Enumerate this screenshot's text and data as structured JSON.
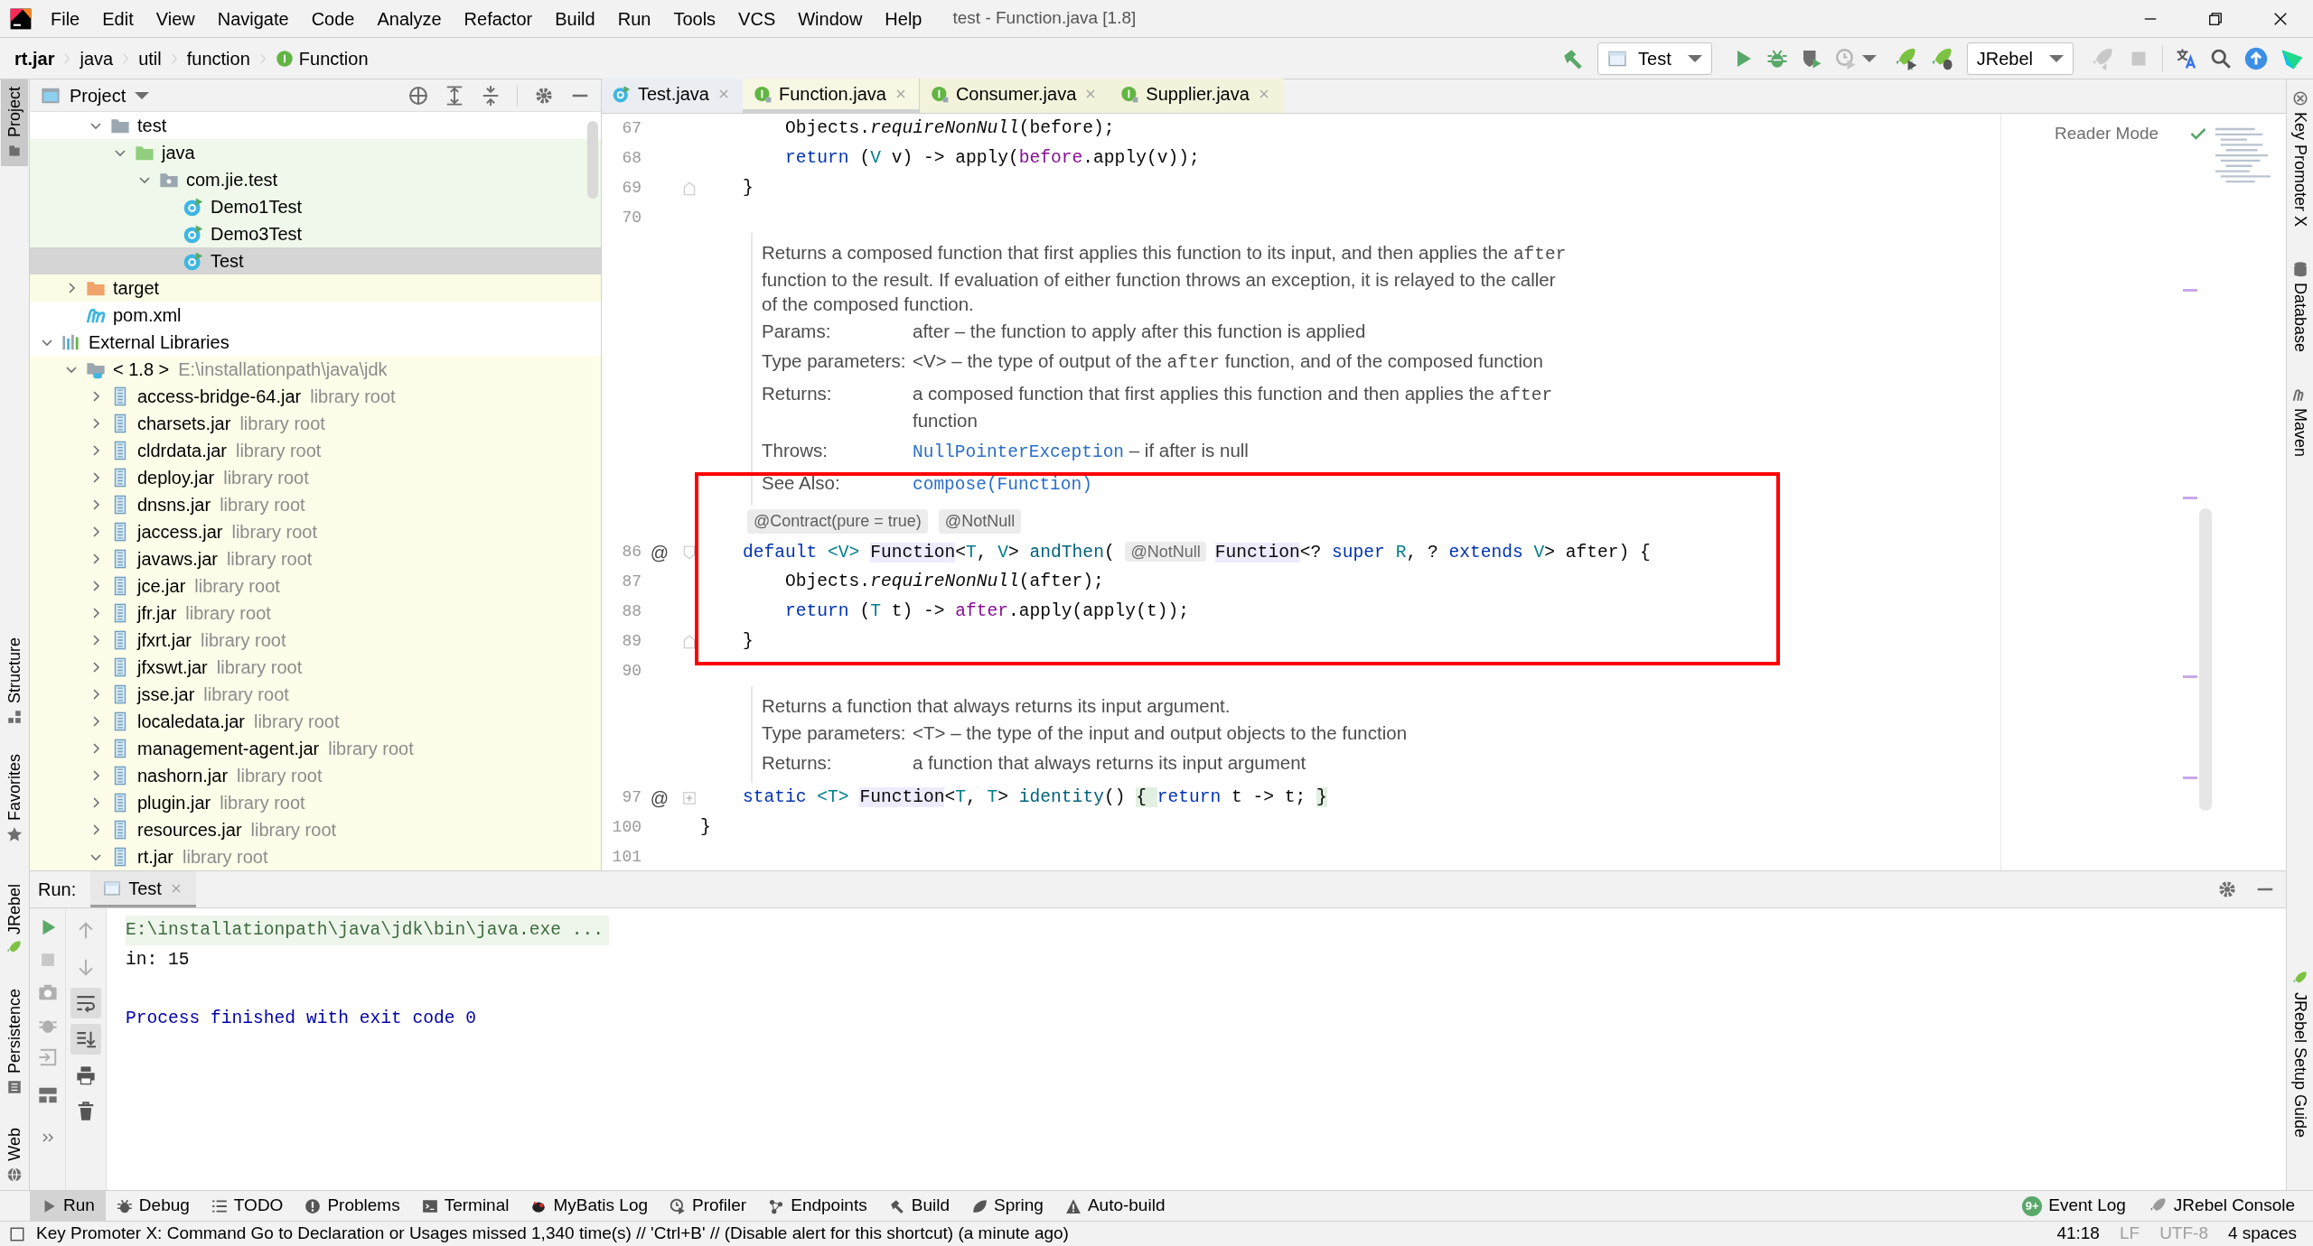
{
  "menu": [
    "File",
    "Edit",
    "View",
    "Navigate",
    "Code",
    "Analyze",
    "Refactor",
    "Build",
    "Run",
    "Tools",
    "VCS",
    "Window",
    "Help"
  ],
  "window_title": "test - Function.java [1.8]",
  "breadcrumbs": [
    {
      "label": "rt.jar",
      "kind": "jar"
    },
    {
      "label": "java",
      "kind": "dir"
    },
    {
      "label": "util",
      "kind": "dir"
    },
    {
      "label": "function",
      "kind": "dir"
    },
    {
      "label": "Function",
      "kind": "interface"
    }
  ],
  "run_config": "Test",
  "jrebel_config": "JRebel",
  "left_strip": {
    "top": [
      {
        "label": "Project",
        "selected": true
      }
    ],
    "middle": [
      {
        "label": "Structure",
        "selected": false
      },
      {
        "label": "Favorites",
        "selected": false
      }
    ],
    "bottom": [
      {
        "label": "JRebel",
        "selected": false
      },
      {
        "label": "Persistence",
        "selected": false
      },
      {
        "label": "Web",
        "selected": false
      }
    ]
  },
  "right_strip": {
    "top": [
      {
        "label": "Key Promoter X"
      },
      {
        "label": "Database"
      },
      {
        "label": "Maven"
      }
    ],
    "bottom": [
      {
        "label": "JRebel Setup Guide"
      }
    ]
  },
  "project_panel": {
    "title": "Project",
    "tree": [
      {
        "children": [
          {
            "children": [
              {
                "label": "test",
                "kind": "folder",
                "selected": false,
                "expanded": true,
                "children": [
                  {
                    "label": "java",
                    "kind": "test-folder",
                    "selected": false,
                    "expanded": true,
                    "children": [
                      {
                        "label": "com.jie.test",
                        "kind": "package",
                        "selected": false,
                        "expanded": true,
                        "children": [
                          {
                            "label": "Demo1Test",
                            "kind": "class",
                            "selected": false
                          },
                          {
                            "label": "Demo3Test",
                            "kind": "class",
                            "selected": false
                          },
                          {
                            "label": "Test",
                            "kind": "class",
                            "selected": true
                          }
                        ]
                      }
                    ]
                  }
                ]
              }
            ]
          },
          {
            "label": "target",
            "kind": "excluded-folder",
            "selected": false,
            "expanded": false
          },
          {
            "label": "pom.xml",
            "kind": "maven",
            "selected": false
          }
        ]
      },
      {
        "label": "External Libraries",
        "kind": "libraries",
        "selected": false,
        "expanded": true,
        "children": [
          {
            "label": "< 1.8 >",
            "hint": "E:\\installationpath\\java\\jdk",
            "kind": "jdk",
            "selected": false,
            "expanded": true,
            "children": [
              {
                "label": "access-bridge-64.jar",
                "hint": "library root",
                "kind": "jar",
                "selected": false,
                "expanded": false
              },
              {
                "label": "charsets.jar",
                "hint": "library root",
                "kind": "jar",
                "selected": false,
                "expanded": false
              },
              {
                "label": "cldrdata.jar",
                "hint": "library root",
                "kind": "jar",
                "selected": false,
                "expanded": false
              },
              {
                "label": "deploy.jar",
                "hint": "library root",
                "kind": "jar",
                "selected": false,
                "expanded": false
              },
              {
                "label": "dnsns.jar",
                "hint": "library root",
                "kind": "jar",
                "selected": false,
                "expanded": false
              },
              {
                "label": "jaccess.jar",
                "hint": "library root",
                "kind": "jar",
                "selected": false,
                "expanded": false
              },
              {
                "label": "javaws.jar",
                "hint": "library root",
                "kind": "jar",
                "selected": false,
                "expanded": false
              },
              {
                "label": "jce.jar",
                "hint": "library root",
                "kind": "jar",
                "selected": false,
                "expanded": false
              },
              {
                "label": "jfr.jar",
                "hint": "library root",
                "kind": "jar",
                "selected": false,
                "expanded": false
              },
              {
                "label": "jfxrt.jar",
                "hint": "library root",
                "kind": "jar",
                "selected": false,
                "expanded": false
              },
              {
                "label": "jfxswt.jar",
                "hint": "library root",
                "kind": "jar",
                "selected": false,
                "expanded": false
              },
              {
                "label": "jsse.jar",
                "hint": "library root",
                "kind": "jar",
                "selected": false,
                "expanded": false
              },
              {
                "label": "localedata.jar",
                "hint": "library root",
                "kind": "jar",
                "selected": false,
                "expanded": false
              },
              {
                "label": "management-agent.jar",
                "hint": "library root",
                "kind": "jar",
                "selected": false,
                "expanded": false
              },
              {
                "label": "nashorn.jar",
                "hint": "library root",
                "kind": "jar",
                "selected": false,
                "expanded": false
              },
              {
                "label": "plugin.jar",
                "hint": "library root",
                "kind": "jar",
                "selected": false,
                "expanded": false
              },
              {
                "label": "resources.jar",
                "hint": "library root",
                "kind": "jar",
                "selected": false,
                "expanded": false
              },
              {
                "label": "rt.jar",
                "hint": "library root",
                "kind": "jar",
                "selected": false,
                "expanded": true
              }
            ]
          }
        ]
      }
    ]
  },
  "editor_tabs": [
    {
      "label": "Test.java",
      "kind": "class",
      "library": false,
      "selected": false
    },
    {
      "label": "Function.java",
      "kind": "interface",
      "library": true,
      "selected": true
    },
    {
      "label": "Consumer.java",
      "kind": "interface",
      "library": true,
      "selected": false
    },
    {
      "label": "Supplier.java",
      "kind": "interface",
      "library": true,
      "selected": false
    }
  ],
  "reader_mode": "Reader Mode",
  "editor_rows": [
    {
      "kind": "code",
      "line": "67",
      "tokens": [
        {
          "text": "        Objects.",
          "kind": "plain"
        },
        {
          "text": "requireNonNull",
          "kind": "italic"
        },
        {
          "text": "(before);",
          "kind": "plain"
        }
      ]
    },
    {
      "kind": "code",
      "line": "68",
      "tokens": [
        {
          "text": "        return",
          "kind": "keyword"
        },
        {
          "text": " (",
          "kind": "plain"
        },
        {
          "text": "V",
          "kind": "typeparam"
        },
        {
          "text": " v) -> apply(",
          "kind": "plain"
        },
        {
          "text": "before",
          "kind": "param"
        },
        {
          "text": ".apply(v));",
          "kind": "plain"
        }
      ]
    },
    {
      "kind": "code",
      "line": "69",
      "fold": {
        "kind": "end"
      },
      "tokens": [
        {
          "text": "    }",
          "kind": "plain"
        }
      ]
    },
    {
      "kind": "code",
      "line": "70"
    },
    {
      "kind": "doc",
      "paragraph": [
        {
          "text": "Returns a composed function that first applies this function to its input, and then applies the "
        },
        {
          "text": "after",
          "kind": "code"
        },
        {
          "text": " function to the result. If evaluation of either function throws an exception, it is relayed to the caller of the composed function."
        }
      ],
      "fields": [
        {
          "label": "Params:",
          "value": [
            {
              "text": "after – the function to apply after this function is applied"
            }
          ]
        },
        {
          "label": "Type parameters:",
          "value": [
            {
              "text": "<V> – the type of output of the "
            },
            {
              "text": "after",
              "kind": "code"
            },
            {
              "text": " function, and of the composed function"
            }
          ]
        },
        {
          "label": "Returns:",
          "value": [
            {
              "text": "a composed function that first applies this function and then applies the "
            },
            {
              "text": "after",
              "kind": "code"
            },
            {
              "text": " function"
            }
          ]
        },
        {
          "label": "Throws:",
          "value": [
            {
              "text": "NullPointerException",
              "kind": "link"
            },
            {
              "text": " – if after is null"
            }
          ]
        },
        {
          "label": "See Also:",
          "value": [
            {
              "text": "compose(Function)",
              "kind": "link"
            }
          ]
        }
      ]
    },
    {
      "kind": "inlay",
      "hints": [
        "@Contract(pure = true)",
        "@NotNull"
      ]
    },
    {
      "kind": "code",
      "line": "86",
      "marker": "@",
      "fold": {
        "kind": "start"
      },
      "tokens": [
        {
          "text": "    default",
          "kind": "keyword"
        },
        {
          "text": " <V> ",
          "kind": "typeparam"
        },
        {
          "text": "Function",
          "kind": "usage"
        },
        {
          "text": "<",
          "kind": "plain"
        },
        {
          "text": "T",
          "kind": "typeparam"
        },
        {
          "text": ", ",
          "kind": "plain"
        },
        {
          "text": "V",
          "kind": "typeparam"
        },
        {
          "text": "> ",
          "kind": "plain"
        },
        {
          "text": "andThen",
          "kind": "method"
        },
        {
          "text": "( ",
          "kind": "plain"
        },
        {
          "text": "@NotNull",
          "kind": "inlay"
        },
        {
          "text": "Function",
          "kind": "usage"
        },
        {
          "text": "<? ",
          "kind": "plain"
        },
        {
          "text": "super",
          "kind": "keyword"
        },
        {
          "text": " R",
          "kind": "typeparam"
        },
        {
          "text": ", ? ",
          "kind": "plain"
        },
        {
          "text": "extends",
          "kind": "keyword"
        },
        {
          "text": " V",
          "kind": "typeparam"
        },
        {
          "text": "> after) {",
          "kind": "plain"
        }
      ]
    },
    {
      "kind": "code",
      "line": "87",
      "tokens": [
        {
          "text": "        Objects.",
          "kind": "plain"
        },
        {
          "text": "requireNonNull",
          "kind": "italic"
        },
        {
          "text": "(after);",
          "kind": "plain"
        }
      ]
    },
    {
      "kind": "code",
      "line": "88",
      "tokens": [
        {
          "text": "        return",
          "kind": "keyword"
        },
        {
          "text": " (",
          "kind": "plain"
        },
        {
          "text": "T",
          "kind": "typeparam"
        },
        {
          "text": " t) -> ",
          "kind": "plain"
        },
        {
          "text": "after",
          "kind": "param"
        },
        {
          "text": ".apply(apply(t));",
          "kind": "plain"
        }
      ]
    },
    {
      "kind": "code",
      "line": "89",
      "fold": {
        "kind": "end"
      },
      "tokens": [
        {
          "text": "    }",
          "kind": "plain"
        }
      ]
    },
    {
      "kind": "code",
      "line": "90"
    },
    {
      "kind": "doc",
      "paragraph": [
        {
          "text": "Returns a function that always returns its input argument."
        }
      ],
      "fields": [
        {
          "label": "Type parameters:",
          "value": [
            {
              "text": "<T> – the type of the input and output objects to the function"
            }
          ]
        },
        {
          "label": "Returns:",
          "value": [
            {
              "text": "a function that always returns its input argument"
            }
          ]
        }
      ]
    },
    {
      "kind": "code",
      "line": "97",
      "marker": "@",
      "fold": {
        "kind": "collapsed"
      },
      "tokens": [
        {
          "text": "    static",
          "kind": "keyword"
        },
        {
          "text": " <T> ",
          "kind": "typeparam"
        },
        {
          "text": "Function",
          "kind": "usage"
        },
        {
          "text": "<",
          "kind": "plain"
        },
        {
          "text": "T",
          "kind": "typeparam"
        },
        {
          "text": ", ",
          "kind": "plain"
        },
        {
          "text": "T",
          "kind": "typeparam"
        },
        {
          "text": "> ",
          "kind": "plain"
        },
        {
          "text": "identity",
          "kind": "method"
        },
        {
          "text": "() ",
          "kind": "plain"
        },
        {
          "text": "{ ",
          "kind": "brace"
        },
        {
          "text": "return",
          "kind": "keyword"
        },
        {
          "text": " t -> t; ",
          "kind": "plain"
        },
        {
          "text": "}",
          "kind": "brace"
        }
      ]
    },
    {
      "kind": "code",
      "line": "100",
      "tokens": [
        {
          "text": "}",
          "kind": "plain"
        }
      ]
    },
    {
      "kind": "code",
      "line": "101"
    }
  ],
  "run_panel": {
    "label": "Run:",
    "tab": {
      "label": "Test",
      "selected": true
    },
    "toolbar": [
      {
        "kind": "up",
        "selected": false
      },
      {
        "kind": "down",
        "selected": false
      },
      {
        "kind": "wrap",
        "selected": true
      },
      {
        "kind": "scroll",
        "selected": true
      },
      {
        "kind": "print",
        "selected": false
      },
      {
        "kind": "trash",
        "selected": false
      }
    ],
    "console": [
      {
        "text": "E:\\installationpath\\java\\jdk\\bin\\java.exe ...",
        "kind": "command"
      },
      {
        "text": "in: 15",
        "kind": "output"
      },
      {
        "text": "Process finished with exit code 0",
        "kind": "system"
      }
    ]
  },
  "tool_windows": [
    {
      "label": "Run",
      "kind": "run",
      "selected": true
    },
    {
      "label": "Debug",
      "kind": "bug",
      "selected": false
    },
    {
      "label": "TODO",
      "kind": "list",
      "selected": false
    },
    {
      "label": "Problems",
      "kind": "info",
      "selected": false
    },
    {
      "label": "Terminal",
      "kind": "terminal",
      "selected": false
    },
    {
      "label": "MyBatis Log",
      "kind": "bird",
      "selected": false
    },
    {
      "label": "Profiler",
      "kind": "clock",
      "selected": false
    },
    {
      "label": "Endpoints",
      "kind": "nodes",
      "selected": false
    },
    {
      "label": "Build",
      "kind": "hammer",
      "selected": false
    },
    {
      "label": "Spring",
      "kind": "leaf",
      "selected": false
    },
    {
      "label": "Auto-build",
      "kind": "warning",
      "selected": false
    }
  ],
  "tool_windows_right": [
    {
      "label": "Event Log",
      "badge": "9+"
    },
    {
      "label": "JRebel Console"
    }
  ],
  "status_bar": {
    "message": "Key Promoter X: Command Go to Declaration or Usages missed 1,340 time(s) // 'Ctrl+B' // (Disable alert for this shortcut) (a minute ago)",
    "items": [
      {
        "text": "41:18",
        "disabled": false
      },
      {
        "text": "LF",
        "disabled": true
      },
      {
        "text": "UTF-8",
        "disabled": true
      },
      {
        "text": "4 spaces",
        "disabled": false
      }
    ]
  }
}
